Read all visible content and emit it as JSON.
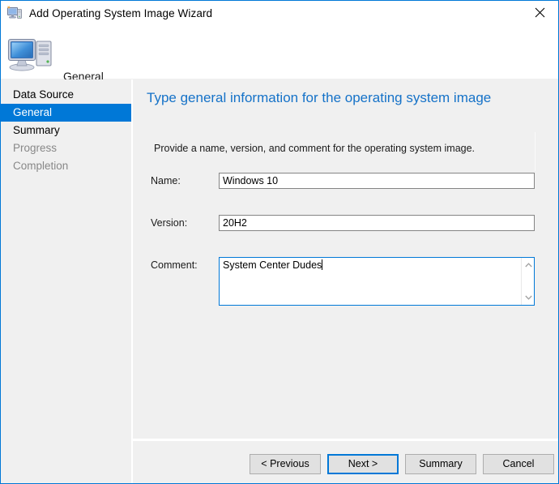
{
  "window": {
    "title": "Add Operating System Image Wizard",
    "icon": "wizard-computer-icon",
    "close_label": "✕",
    "accent_color": "#0078d7",
    "background_color": "#f0f0f0"
  },
  "header": {
    "page_name": "General",
    "icon": "computer-icon"
  },
  "sidebar": {
    "items": [
      {
        "label": "Data Source",
        "state": "normal"
      },
      {
        "label": "General",
        "state": "selected"
      },
      {
        "label": "Summary",
        "state": "normal"
      },
      {
        "label": "Progress",
        "state": "disabled"
      },
      {
        "label": "Completion",
        "state": "disabled"
      }
    ]
  },
  "content": {
    "heading": "Type general information for the operating system image",
    "description": "Provide a name, version, and comment for the operating system image.",
    "heading_color": "#1572c8",
    "fields": {
      "name": {
        "label": "Name:",
        "value": "Windows 10",
        "placeholder": ""
      },
      "version": {
        "label": "Version:",
        "value": "20H2",
        "placeholder": ""
      },
      "comment": {
        "label": "Comment:",
        "value": "System Center Dudes",
        "placeholder": "",
        "focused": true
      }
    }
  },
  "footer": {
    "buttons": [
      {
        "label": "< Previous",
        "default": false
      },
      {
        "label": "Next >",
        "default": true
      },
      {
        "label": "Summary",
        "default": false
      },
      {
        "label": "Cancel",
        "default": false
      }
    ]
  }
}
